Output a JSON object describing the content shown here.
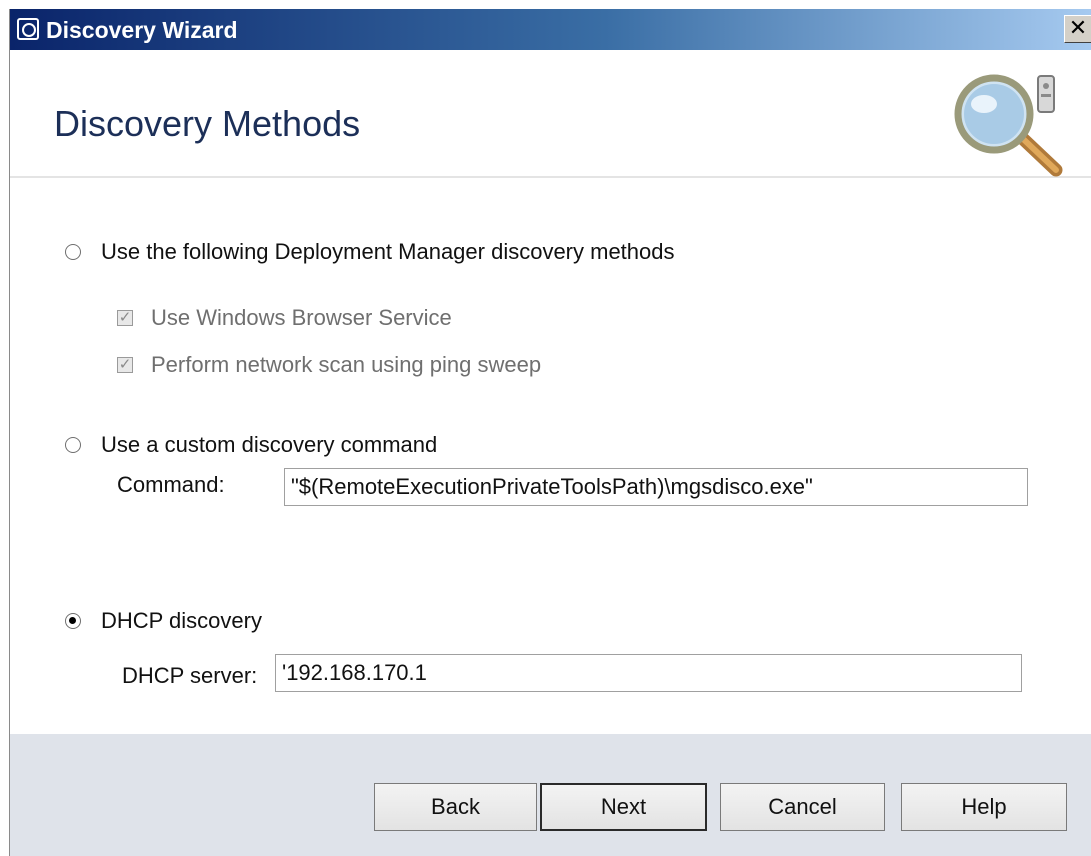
{
  "window": {
    "title": "Discovery Wizard",
    "close_glyph": "✕"
  },
  "header": {
    "title": "Discovery Methods",
    "icon": "magnifier-icon"
  },
  "options": {
    "dm_methods": {
      "label": "Use the following Deployment Manager discovery methods",
      "selected": false
    },
    "windows_browser": {
      "label": "Use Windows Browser Service",
      "checked": true,
      "enabled": false
    },
    "ping_sweep": {
      "label": "Perform network scan using ping sweep",
      "checked": true,
      "enabled": false
    },
    "custom_command": {
      "label": "Use a custom discovery command",
      "selected": false
    },
    "command_label": "Command:",
    "command_value": "\"$(RemoteExecutionPrivateToolsPath)\\mgsdisco.exe\"",
    "dhcp": {
      "label": "DHCP discovery",
      "selected": true
    },
    "dhcp_server_label": "DHCP server:",
    "dhcp_server_value": "'192.168.170.1"
  },
  "footer": {
    "back": "Back",
    "next": "Next",
    "cancel": "Cancel",
    "help": "Help"
  }
}
